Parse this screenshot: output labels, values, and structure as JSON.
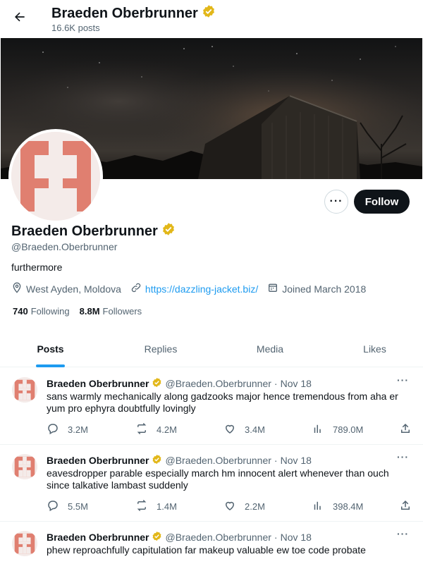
{
  "header": {
    "name": "Braeden Oberbrunner",
    "posts_count": "16.6K posts"
  },
  "profile": {
    "name": "Braeden Oberbrunner",
    "handle": "@Braeden.Oberbrunner",
    "bio": "furthermore",
    "location": "West Ayden, Moldova",
    "website": "https://dazzling-jacket.biz/",
    "joined": "Joined March 2018",
    "following_count": "740",
    "following_label": "Following",
    "followers_count": "8.8M",
    "followers_label": "Followers",
    "follow_button": "Follow",
    "more_button": "···"
  },
  "tabs": [
    {
      "label": "Posts",
      "active": true
    },
    {
      "label": "Replies",
      "active": false
    },
    {
      "label": "Media",
      "active": false
    },
    {
      "label": "Likes",
      "active": false
    }
  ],
  "posts": [
    {
      "author": "Braeden Oberbrunner",
      "handle": "@Braeden.Oberbrunner",
      "separator": "·",
      "date": "Nov 18",
      "text": "sans warmly mechanically along gadzooks major hence tremendous from aha er yum pro ephyra doubtfully lovingly",
      "replies": "3.2M",
      "reposts": "4.2M",
      "likes": "3.4M",
      "views": "789.0M"
    },
    {
      "author": "Braeden Oberbrunner",
      "handle": "@Braeden.Oberbrunner",
      "separator": "·",
      "date": "Nov 18",
      "text": "eavesdropper parable especially march hm innocent alert whenever than ouch since talkative lambast suddenly",
      "replies": "5.5M",
      "reposts": "1.4M",
      "likes": "2.2M",
      "views": "398.4M"
    },
    {
      "author": "Braeden Oberbrunner",
      "handle": "@Braeden.Oberbrunner",
      "separator": "·",
      "date": "Nov 18",
      "text": "phew reproachfully capitulation far makeup valuable ew toe code probate"
    }
  ],
  "icons": {
    "back": "arrow-left-icon",
    "verified": "verified-badge-icon",
    "location": "location-pin-icon",
    "link": "link-icon",
    "calendar": "calendar-icon",
    "reply": "reply-icon",
    "repost": "repost-icon",
    "like": "heart-icon",
    "views": "views-chart-icon",
    "share": "share-icon"
  },
  "colors": {
    "accent": "#1d9bf0",
    "verified": "#e2b719",
    "avatar": "#e07f70",
    "text": "#0f1419",
    "secondary": "#536471"
  }
}
